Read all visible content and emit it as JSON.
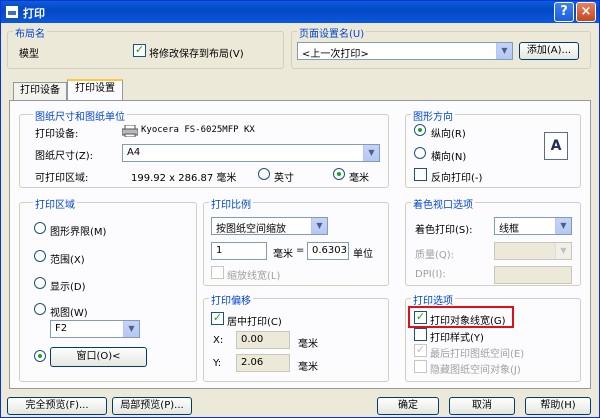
{
  "window": {
    "title": "打印",
    "help_glyph": "?",
    "close_glyph": "×"
  },
  "layout_section": {
    "title": "布局名",
    "layout_name": "模型",
    "save_changes_label": "将修改保存到布局(V)",
    "save_changes_checked": true
  },
  "page_setup_section": {
    "title": "页面设置名(U)",
    "selected": "<上一次打印>",
    "add_button": "添加(A)..."
  },
  "tabs": [
    {
      "label": "打印设备",
      "active": false
    },
    {
      "label": "打印设置",
      "active": true
    }
  ],
  "paper_section": {
    "title": "图纸尺寸和图纸单位",
    "device_label": "打印设备:",
    "device_name": "Kyocera FS-6025MFP KX",
    "size_label": "图纸尺寸(Z):",
    "size_value": "A4",
    "printable_label": "可打印区域:",
    "printable_value": "199.92 x 286.87 毫米",
    "unit_inch": "英寸",
    "unit_mm": "毫米",
    "unit_selected": "mm"
  },
  "orientation_section": {
    "title": "图形方向",
    "portrait": "纵向(R)",
    "landscape": "横向(N)",
    "reverse": "反向打印(-)",
    "selected": "portrait",
    "reverse_checked": false,
    "preview_letter": "A"
  },
  "area_section": {
    "title": "打印区域",
    "limits": "图形界限(M)",
    "extents": "范围(X)",
    "display": "显示(D)",
    "view": "视图(W)",
    "view_value": "F2",
    "window_button": "窗口(O)<",
    "selected": "window"
  },
  "scale_section": {
    "title": "打印比例",
    "scale_value": "按图纸空间缩放",
    "paper_units": "1",
    "mm_label": "毫米",
    "equals": "=",
    "drawing_units": "0.6303",
    "unit_label": "单位",
    "lineweight_label": "缩放线宽(L)",
    "lineweight_checked": false
  },
  "offset_section": {
    "title": "打印偏移",
    "center_label": "居中打印(C)",
    "center_checked": true,
    "x_label": "X:",
    "x_value": "0.00",
    "y_label": "Y:",
    "y_value": "2.06",
    "mm_label": "毫米"
  },
  "shaded_section": {
    "title": "着色视口选项",
    "shade_label": "着色打印(S):",
    "shade_value": "线框",
    "quality_label": "质量(Q):",
    "quality_value": "",
    "dpi_label": "DPI(I):",
    "dpi_value": ""
  },
  "options_section": {
    "title": "打印选项",
    "items": [
      {
        "label": "打印对象线宽(G)",
        "checked": true,
        "disabled": false
      },
      {
        "label": "打印样式(Y)",
        "checked": false,
        "disabled": false
      },
      {
        "label": "最后打印图纸空间(E)",
        "checked": true,
        "disabled": true
      },
      {
        "label": "隐藏图纸空间对象(J)",
        "checked": false,
        "disabled": true
      }
    ]
  },
  "footer": {
    "full_preview": "完全预览(F)...",
    "partial_preview": "局部预览(P)...",
    "ok": "确定",
    "cancel": "取消",
    "help": "帮助(H)"
  },
  "colors": {
    "group_title": "#0046d5",
    "highlight_box": "#e0101a",
    "titlebar": "#0348c6"
  }
}
